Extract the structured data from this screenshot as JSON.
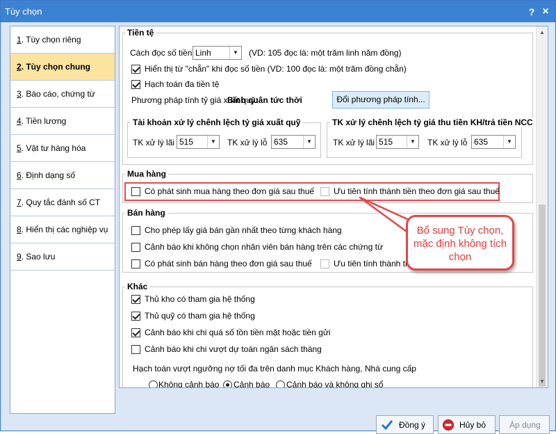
{
  "window": {
    "title": "Tùy chọn",
    "help_label": "?",
    "close_label": "×"
  },
  "sidebar": {
    "items": [
      {
        "key": "1",
        "label": ". Tùy chọn riêng",
        "active": false
      },
      {
        "key": "2",
        "label": ". Tùy chọn chung",
        "active": true
      },
      {
        "key": "3",
        "label": ". Báo cáo, chứng từ",
        "active": false
      },
      {
        "key": "4",
        "label": ". Tiền lương",
        "active": false
      },
      {
        "key": "5",
        "label": ". Vật tư hàng hóa",
        "active": false
      },
      {
        "key": "6",
        "label": ". Định dạng số",
        "active": false
      },
      {
        "key": "7",
        "label": ". Quy tắc đánh số CT",
        "active": false
      },
      {
        "key": "8",
        "label": ". Hiển thị các nghiệp vụ",
        "active": false
      },
      {
        "key": "9",
        "label": ". Sao lưu",
        "active": false
      }
    ]
  },
  "currency": {
    "title": "Tiền tệ",
    "read_method_label": "Cách đọc số tiền",
    "read_method_value": "Linh",
    "read_method_example": "(VD: 105 đọc là: một trăm linh năm đồng)",
    "show_chan_label": "Hiển thị từ \"chẵn\" khi đọc số tiền (VD: 100 đọc là: một trăm đồng chẵn)",
    "show_chan_checked": true,
    "multi_currency_label": "Hạch toán đa tiền tệ",
    "multi_currency_checked": true,
    "rate_method_label": "Phương pháp tính tỷ giá xuất quỹ:",
    "rate_method_value": "Bình quân tức thời",
    "change_method_button": "Đổi phương pháp tính...",
    "fx_account_group": {
      "title": "Tài khoản xử lý chênh lệch tỷ giá xuất quỹ",
      "gain_label": "TK xử lý lãi",
      "gain_value": "515",
      "loss_label": "TK xử lý lỗ",
      "loss_value": "635"
    },
    "fx_receivable_group": {
      "title": "TK xử lý chênh lệch tỷ giá thu tiền KH/trả tiền NCC",
      "gain_label": "TK xử lý lãi",
      "gain_value": "515",
      "loss_label": "TK xử lý lỗ",
      "loss_value": "635"
    }
  },
  "purchase": {
    "title": "Mua hàng",
    "after_tax_label": "Có phát sinh mua hàng theo đơn giá sau thuế",
    "after_tax_checked": false,
    "priority_label": "Ưu tiên tính thành tiền theo đơn giá sau thuế",
    "priority_checked": false
  },
  "sales": {
    "title": "Bán hàng",
    "latest_price_label": "Cho phép lấy giá bán gần nhất theo từng khách hàng",
    "no_staff_warning_label": "Cảnh báo khi không chọn nhân viên bán hàng trên các chứng từ",
    "after_tax_label": "Có phát sinh bán hàng theo đơn giá sau thuế",
    "priority_label_partial": "Ưu tiên tính thành tiề"
  },
  "other": {
    "title": "Khác",
    "items": [
      {
        "label": "Thủ kho có tham gia hệ thống",
        "checked": true
      },
      {
        "label": "Thủ quỹ có tham gia hệ thống",
        "checked": true
      },
      {
        "label": "Cảnh báo khi chi quá số tồn tiền mặt hoặc tiền gửi",
        "checked": true
      },
      {
        "label": "Cảnh báo khi chi vượt dự toán ngân sách tháng",
        "checked": false
      }
    ],
    "debt_limit_label": "Hạch toán vượt ngưỡng nợ tối đa trên danh mục Khách hàng, Nhà cung cấp",
    "radios": [
      {
        "label": "Không cảnh báo",
        "checked": false
      },
      {
        "label": "Cảnh báo",
        "checked": true
      },
      {
        "label": "Cảnh báo và không ghi sổ",
        "checked": false
      }
    ]
  },
  "callout": {
    "line1": "Bổ sung Tùy chọn,",
    "line2": "mặc định không tích",
    "line3": "chọn"
  },
  "buttons": {
    "ok": "Đồng ý",
    "cancel": "Hủy bỏ",
    "apply": "Áp dụng"
  },
  "colors": {
    "titlebar": "#3c82d2",
    "active_nav": "#fbe3a0",
    "annotation_red": "#e04848"
  }
}
